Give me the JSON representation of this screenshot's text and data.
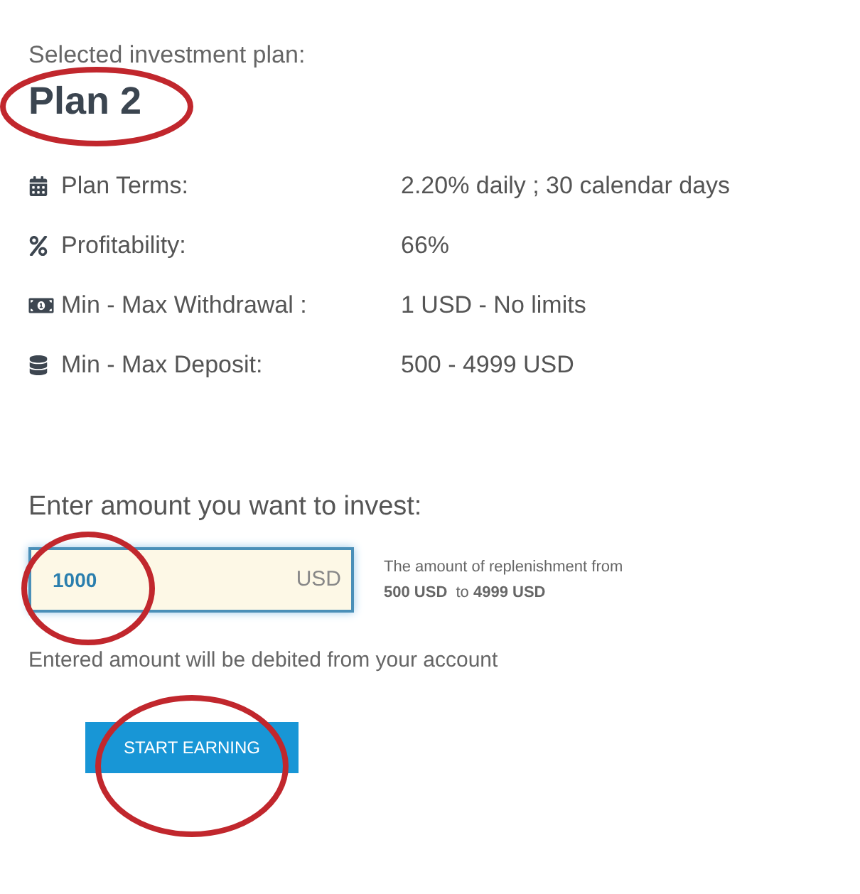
{
  "plan": {
    "caption": "Selected investment plan:",
    "name": "Plan 2",
    "circled": true
  },
  "details": [
    {
      "kind": "terms",
      "label": "Plan Terms:",
      "value": "2.20% daily ; 30 calendar days"
    },
    {
      "kind": "profit",
      "label": "Profitability:",
      "value": "66%"
    },
    {
      "kind": "withdrawal",
      "label": "Min - Max Withdrawal :",
      "value": "1 USD - No limits"
    },
    {
      "kind": "deposit",
      "label": "Min - Max Deposit:",
      "value": "500 - 4999 USD"
    }
  ],
  "amount": {
    "label": "Enter amount you want to invest:",
    "value": "1000",
    "currency": "USD",
    "circled": true,
    "hint": "The amount of replenishment from\n**500 USD**  to **4999 USD**",
    "note": "Entered amount will be debited from your account"
  },
  "submit_button": {
    "label": "START EARNING",
    "circled": true
  }
}
